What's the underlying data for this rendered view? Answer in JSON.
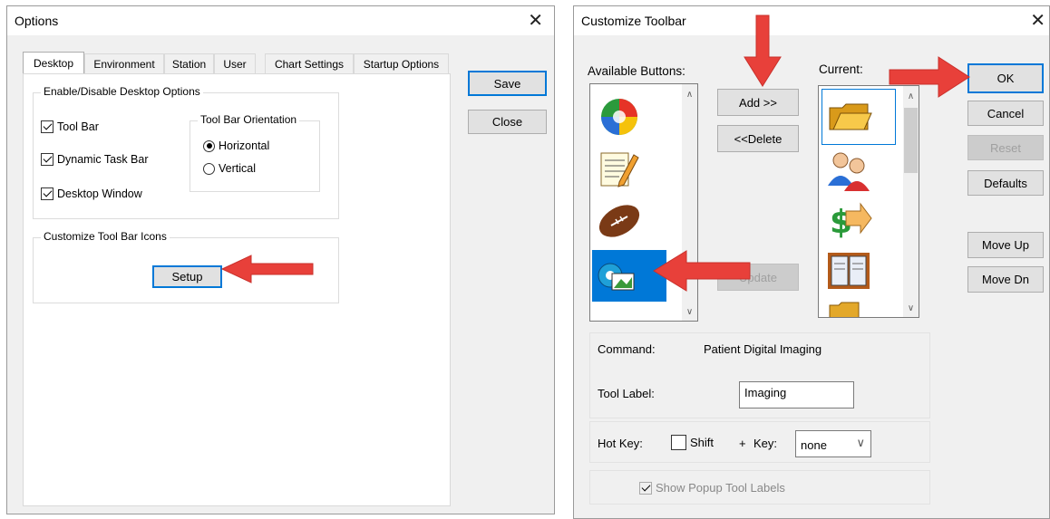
{
  "options": {
    "title": "Options",
    "tabs": [
      "Desktop",
      "Environment",
      "Station",
      "User",
      "Chart Settings",
      "Startup Options"
    ],
    "desktop_group": "Enable/Disable Desktop Options",
    "checks": [
      "Tool Bar",
      "Dynamic Task Bar",
      "Desktop Window"
    ],
    "orientation_group": "Tool Bar Orientation",
    "orient_h": "Horizontal",
    "orient_v": "Vertical",
    "customize_group": "Customize Tool Bar Icons",
    "setup": "Setup",
    "save": "Save",
    "close": "Close"
  },
  "customize": {
    "title": "Customize Toolbar",
    "available_label": "Available Buttons:",
    "current_label": "Current:",
    "add": "Add >>",
    "delete": "<<Delete",
    "update": "Update",
    "ok": "OK",
    "cancel": "Cancel",
    "reset": "Reset",
    "defaults": "Defaults",
    "move_up": "Move Up",
    "move_dn": "Move Dn",
    "command_label": "Command:",
    "command_value": "Patient Digital Imaging",
    "tool_label": "Tool Label:",
    "tool_value": "Imaging",
    "hotkey_label": "Hot Key:",
    "shift_label": "Shift",
    "plus": "+",
    "key_label": "Key:",
    "key_value": "none",
    "popup_label": "Show Popup Tool Labels",
    "available_icons": [
      "color-ball-icon",
      "notepad-pencil-icon",
      "football-icon",
      "digital-imaging-icon"
    ],
    "current_icons": [
      "open-folder-icon",
      "patients-icon",
      "money-arrow-icon",
      "book-icon",
      "folder-icon"
    ]
  },
  "colors": {
    "accent": "#0078d7",
    "arrow": "#e8403a",
    "selection": "#0078d7"
  }
}
